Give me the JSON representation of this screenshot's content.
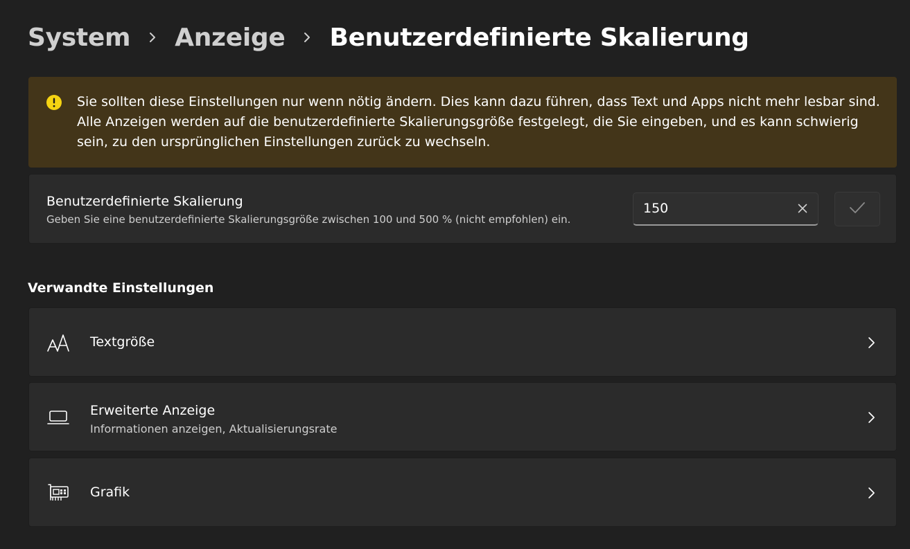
{
  "breadcrumb": {
    "items": [
      "System",
      "Anzeige",
      "Benutzerdefinierte Skalierung"
    ]
  },
  "warning": {
    "icon": "warning-icon",
    "text": "Sie sollten diese Einstellungen nur wenn nötig ändern. Dies kann dazu führen, dass Text und Apps nicht mehr lesbar sind. Alle Anzeigen werden auf die benutzerdefinierte Skalierungsgröße festgelegt, die Sie eingeben, und es kann schwierig sein, zu den ursprünglichen Einstellungen zurück zu wechseln."
  },
  "scaling": {
    "title": "Benutzerdefinierte Skalierung",
    "description": "Geben Sie eine benutzerdefinierte Skalierungsgröße zwischen 100 und 500 % (nicht empfohlen) ein.",
    "value": "150"
  },
  "related": {
    "title": "Verwandte Einstellungen",
    "items": [
      {
        "label": "Textgröße",
        "subtitle": "",
        "icon": "text-size-icon"
      },
      {
        "label": "Erweiterte Anzeige",
        "subtitle": "Informationen anzeigen, Aktualisierungsrate",
        "icon": "laptop-icon"
      },
      {
        "label": "Grafik",
        "subtitle": "",
        "icon": "graphics-card-icon"
      }
    ]
  },
  "colors": {
    "background": "#202020",
    "card": "#2b2b2b",
    "warning_background": "#433519",
    "warning_icon": "#f5d312"
  }
}
